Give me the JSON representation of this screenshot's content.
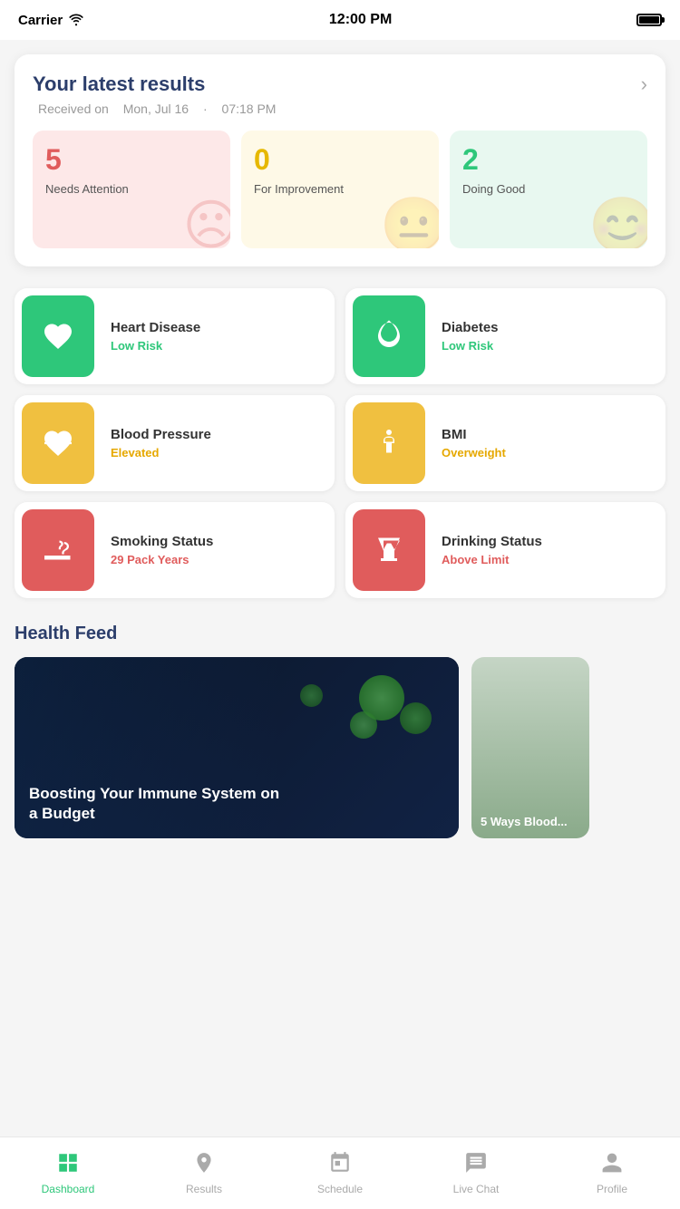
{
  "statusBar": {
    "carrier": "Carrier",
    "time": "12:00 PM",
    "battery": "full"
  },
  "resultsCard": {
    "title": "Your latest results",
    "datePrefix": "Received on",
    "date": "Mon, Jul 16",
    "separator": "·",
    "time": "07:18 PM",
    "chevron": "›",
    "boxes": [
      {
        "number": "5",
        "label": "Needs Attention",
        "theme": "red"
      },
      {
        "number": "0",
        "label": "For Improvement",
        "theme": "yellow"
      },
      {
        "number": "2",
        "label": "Doing Good",
        "theme": "green"
      }
    ]
  },
  "healthCards": [
    {
      "name": "Heart Disease",
      "status": "Low Risk",
      "statusClass": "status-green",
      "iconColor": "green",
      "iconType": "heart"
    },
    {
      "name": "Diabetes",
      "status": "Low Risk",
      "statusClass": "status-green",
      "iconColor": "green",
      "iconType": "drop"
    },
    {
      "name": "Blood Pressure",
      "status": "Elevated",
      "statusClass": "status-yellow",
      "iconColor": "yellow",
      "iconType": "heartbeat"
    },
    {
      "name": "BMI",
      "status": "Overweight",
      "statusClass": "status-yellow",
      "iconColor": "yellow",
      "iconType": "person"
    },
    {
      "name": "Smoking Status",
      "status": "29 Pack Years",
      "statusClass": "status-red",
      "iconColor": "red",
      "iconType": "smoke"
    },
    {
      "name": "Drinking Status",
      "status": "Above Limit",
      "statusClass": "status-red",
      "iconColor": "red",
      "iconType": "drink"
    }
  ],
  "healthFeed": {
    "title": "Health Feed",
    "cards": [
      {
        "title": "Boosting Your Immune System on a Budget",
        "type": "main"
      },
      {
        "title": "5 Ways Blood...",
        "type": "side"
      }
    ]
  },
  "bottomNav": {
    "items": [
      {
        "label": "Dashboard",
        "icon": "dashboard",
        "active": true
      },
      {
        "label": "Results",
        "icon": "results",
        "active": false
      },
      {
        "label": "Schedule",
        "icon": "schedule",
        "active": false
      },
      {
        "label": "Live Chat",
        "icon": "chat",
        "active": false
      },
      {
        "label": "Profile",
        "icon": "profile",
        "active": false
      }
    ]
  }
}
